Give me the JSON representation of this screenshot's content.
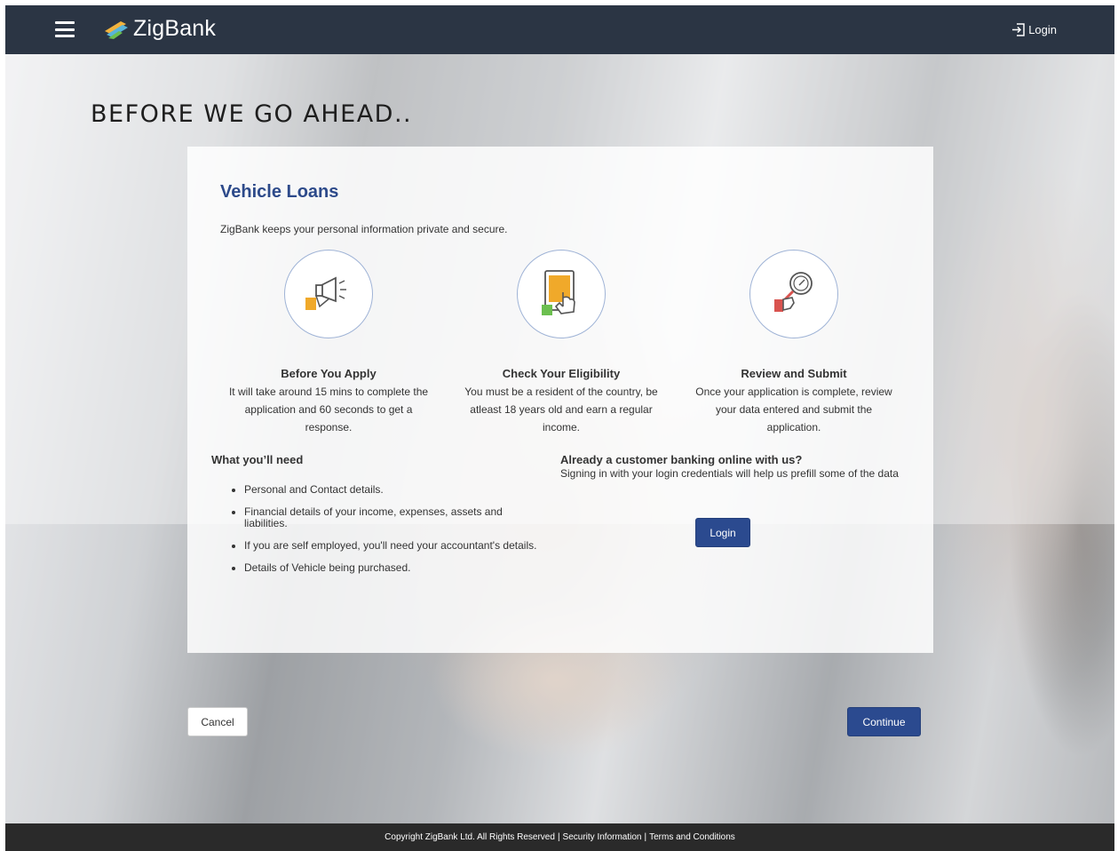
{
  "header": {
    "brand": "ZigBank",
    "login_label": "Login",
    "icons": {
      "menu": "hamburger-icon",
      "login": "login-arrow-icon",
      "logo": "zigbank-logo-icon"
    }
  },
  "page": {
    "title": "BEFORE WE GO AHEAD.."
  },
  "card": {
    "title": "Vehicle Loans",
    "subtitle": "ZigBank keeps your personal information private and secure.",
    "steps": [
      {
        "title": "Before You Apply",
        "description": "It will take around 15 mins to complete the application and 60 seconds to get a response.",
        "icon": "megaphone-icon"
      },
      {
        "title": "Check Your Eligibility",
        "description": "You must be a resident of the country, be atleast 18 years old and earn a regular income.",
        "icon": "tablet-tap-icon"
      },
      {
        "title": "Review and Submit",
        "description": "Once your application is complete, review your data entered and submit the application.",
        "icon": "magnifier-review-icon"
      }
    ],
    "need": {
      "title": "What you’ll need",
      "items": [
        "Personal and Contact details.",
        "Financial details of your income, expenses, assets and liabilities.",
        "If you are self employed, you'll need your accountant's details.",
        "Details of Vehicle being purchased."
      ]
    },
    "customer": {
      "title": "Already a customer banking online with us?",
      "description": "Signing in with your login credentials will help us prefill some of the data",
      "login_label": "Login"
    }
  },
  "actions": {
    "cancel_label": "Cancel",
    "continue_label": "Continue"
  },
  "footer": {
    "copyright": "Copyright ZigBank Ltd. All Rights Reserved",
    "separator": "|",
    "security": "Security Information",
    "terms": "Terms and Conditions"
  },
  "colors": {
    "topbar": "#2b3544",
    "accent": "#2b4a8f",
    "title": "#2d4a8a",
    "footer": "#2a2a2a"
  }
}
